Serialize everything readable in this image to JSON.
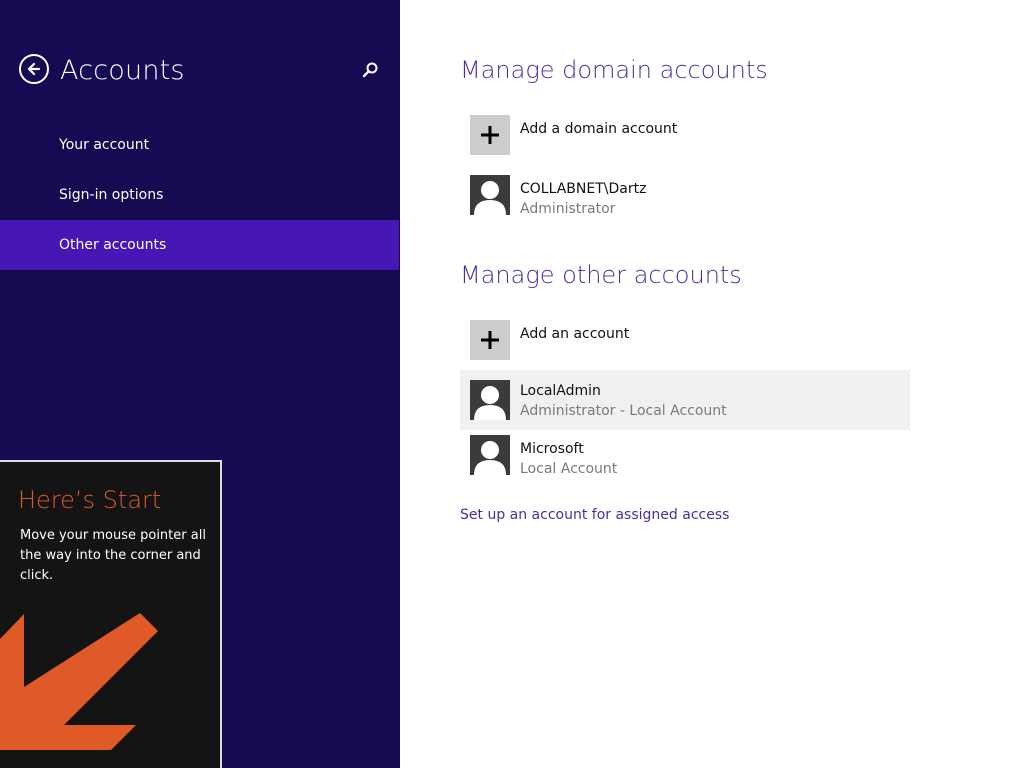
{
  "colors": {
    "sidebar_bg": "#180a52",
    "nav_selected_bg": "#4617b4",
    "heading_accent": "#4c2d9e",
    "tip_title": "#e05a28",
    "tip_bg": "#141414"
  },
  "sidebar": {
    "back_icon": "back-arrow-icon",
    "title": "Accounts",
    "search_icon": "search-icon",
    "items": [
      {
        "label": "Your account",
        "selected": false
      },
      {
        "label": "Sign-in options",
        "selected": false
      },
      {
        "label": "Other accounts",
        "selected": true
      }
    ]
  },
  "tip": {
    "title": "Here’s Start",
    "body": "Move your mouse pointer all the way into the corner and click.",
    "arrow_icon": "arrow-down-left-icon"
  },
  "domain_section": {
    "heading": "Manage domain accounts",
    "add_label": "Add a domain account",
    "accounts": [
      {
        "name": "COLLABNET\\Dartz",
        "type": "Administrator",
        "icon": "user-avatar-icon"
      }
    ]
  },
  "other_section": {
    "heading": "Manage other accounts",
    "add_label": "Add an account",
    "accounts": [
      {
        "name": "LocalAdmin",
        "type": "Administrator - Local Account",
        "icon": "user-avatar-icon",
        "highlighted": true
      },
      {
        "name": "Microsoft",
        "type": "Local Account",
        "icon": "user-avatar-icon",
        "highlighted": false
      }
    ]
  },
  "assigned_access_link": "Set up an account for assigned access"
}
